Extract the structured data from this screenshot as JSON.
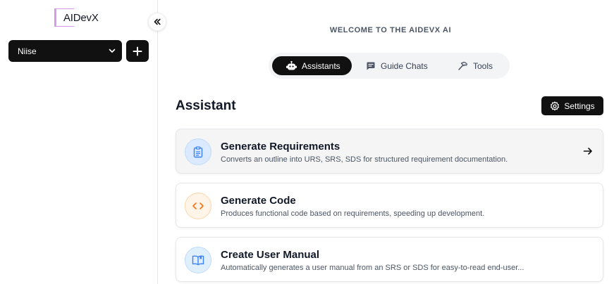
{
  "app": {
    "logo_text": "AIDevX"
  },
  "sidebar": {
    "collapse_icon": "double-chevron-left-icon",
    "project_select": {
      "value": "Niise"
    },
    "add_button_icon": "plus-icon"
  },
  "main": {
    "welcome": "WELCOME TO THE AIDEVX AI",
    "tabs": [
      {
        "label": "Assistants",
        "icon": "robot-icon",
        "active": true
      },
      {
        "label": "Guide Chats",
        "icon": "chat-icon",
        "active": false
      },
      {
        "label": "Tools",
        "icon": "hammer-icon",
        "active": false
      }
    ],
    "section_title": "Assistant",
    "settings_label": "Settings",
    "cards": [
      {
        "title": "Generate Requirements",
        "description": "Converts an outline into URS, SRS, SDS for structured requirement documentation.",
        "icon": "clipboard-icon"
      },
      {
        "title": "Generate Code",
        "description": "Produces functional code based on requirements, speeding up development.",
        "icon": "code-icon"
      },
      {
        "title": "Create User Manual",
        "description": "Automatically generates a user manual from an SRS or SDS for easy-to-read end-user...",
        "icon": "book-icon"
      }
    ]
  },
  "colors": {
    "primary": "#111111",
    "logo_accent": "#d59be9",
    "requirements_accent": "#3b82f6",
    "code_accent": "#f97316",
    "manual_accent": "#3b82f6"
  }
}
